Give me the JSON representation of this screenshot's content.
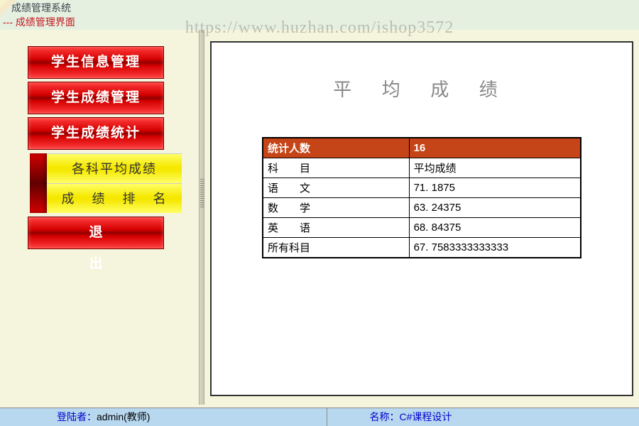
{
  "app": {
    "title": "成绩管理系统",
    "subtitle": "--- 成绩管理界面",
    "watermark": "https://www.huzhan.com/ishop3572"
  },
  "sidebar": {
    "items": [
      {
        "label": "学生信息管理"
      },
      {
        "label": "学生成绩管理"
      },
      {
        "label": "学生成绩统计"
      },
      {
        "label": "退　　出"
      }
    ],
    "submenu": [
      {
        "label": "各科平均成绩"
      },
      {
        "label": "成 绩 排 名"
      }
    ]
  },
  "content": {
    "title": "平 均 成 绩",
    "table": {
      "header": {
        "label": "统计人数",
        "value": "16"
      },
      "subheader": {
        "label": "科　　目",
        "value": "平均成绩"
      },
      "rows": [
        {
          "label": "语　　文",
          "value": "71. 1875"
        },
        {
          "label": "数　　学",
          "value": "63. 24375"
        },
        {
          "label": "英　　语",
          "value": "68. 84375"
        },
        {
          "label": "所有科目",
          "value": "67. 7583333333333"
        }
      ]
    }
  },
  "statusbar": {
    "login_label": "登陆者：",
    "login_value": "admin(教师)",
    "name_label": "名称：",
    "name_value": "C#课程设计"
  }
}
